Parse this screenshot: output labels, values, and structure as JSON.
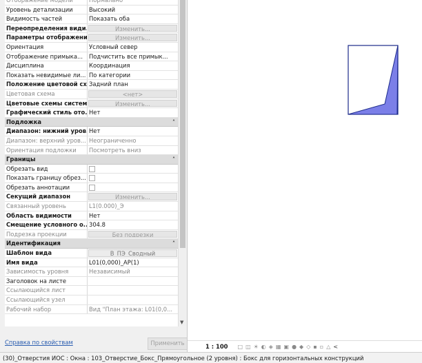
{
  "properties": {
    "rows_top": [
      {
        "name": "Отображение модели",
        "value": "Нормально",
        "style": "gray",
        "kind": "text"
      },
      {
        "name": "Уровень детализации",
        "value": "Высокий",
        "style": "",
        "kind": "text"
      },
      {
        "name": "Видимость частей",
        "value": "Показать оба",
        "style": "",
        "kind": "text"
      },
      {
        "name": "Переопределения види...",
        "value": "Изменить...",
        "style": "bold",
        "kind": "button"
      },
      {
        "name": "Параметры отображени...",
        "value": "Изменить...",
        "style": "bold",
        "kind": "button"
      },
      {
        "name": "Ориентация",
        "value": "Условный север",
        "style": "",
        "kind": "text"
      },
      {
        "name": "Отображение примыка...",
        "value": "Подчистить все примык...",
        "style": "",
        "kind": "text"
      },
      {
        "name": "Дисциплина",
        "value": "Координация",
        "style": "",
        "kind": "text"
      },
      {
        "name": "Показать невидимые ли...",
        "value": "По категории",
        "style": "",
        "kind": "text"
      },
      {
        "name": "Положение цветовой сх...",
        "value": "Задний план",
        "style": "bold",
        "kind": "text"
      },
      {
        "name": "Цветовая схема",
        "value": "<нет>",
        "style": "gray",
        "kind": "button"
      },
      {
        "name": "Цветовые схемы системы",
        "value": "Изменить...",
        "style": "bold",
        "kind": "button"
      },
      {
        "name": "Графический стиль ото...",
        "value": "Нет",
        "style": "bold",
        "kind": "text"
      }
    ],
    "section_underlay": "Подложка",
    "rows_underlay": [
      {
        "name": "Диапазон: нижний уров...",
        "value": "Нет",
        "style": "bold",
        "kind": "text"
      },
      {
        "name": "Диапазон: верхний уров...",
        "value": "Неограниченно",
        "style": "gray",
        "kind": "text"
      },
      {
        "name": "Ориентация подложки",
        "value": "Посмотреть вниз",
        "style": "gray",
        "kind": "text"
      }
    ],
    "section_bounds": "Границы",
    "rows_bounds": [
      {
        "name": "Обрезать вид",
        "value": "",
        "style": "",
        "kind": "check"
      },
      {
        "name": "Показать границу обрез...",
        "value": "",
        "style": "",
        "kind": "check"
      },
      {
        "name": "Обрезать аннотации",
        "value": "",
        "style": "",
        "kind": "check"
      },
      {
        "name": "Секущий диапазон",
        "value": "Изменить...",
        "style": "bold",
        "kind": "button"
      },
      {
        "name": "Связанный уровень",
        "value": "L1(0.000)_Э",
        "style": "gray",
        "kind": "text"
      },
      {
        "name": "Область видимости",
        "value": "Нет",
        "style": "bold",
        "kind": "text"
      },
      {
        "name": "Смещение условного о...",
        "value": "304.8",
        "style": "bold",
        "kind": "text"
      },
      {
        "name": "Подрезка проекции",
        "value": "Без подрезки",
        "style": "gray",
        "kind": "button"
      }
    ],
    "section_identity": "Идентификация",
    "rows_identity": [
      {
        "name": "Шаблон вида",
        "value": "В_ПЭ_Сводный",
        "style": "bold",
        "kind": "buttondark"
      },
      {
        "name": "Имя вида",
        "value": "L01(0,000)_АР(1)",
        "style": "bold",
        "kind": "text"
      },
      {
        "name": "Зависимость уровня",
        "value": "Независимый",
        "style": "gray",
        "kind": "text"
      },
      {
        "name": "Заголовок на листе",
        "value": "",
        "style": "",
        "kind": "text"
      },
      {
        "name": "Ссылающийся лист",
        "value": "",
        "style": "gray",
        "kind": "text"
      },
      {
        "name": "Ссылающийся узел",
        "value": "",
        "style": "gray",
        "kind": "text"
      },
      {
        "name": "Рабочий набор",
        "value": "Вид \"План этажа: L01(0,0...",
        "style": "gray",
        "kind": "text"
      }
    ],
    "help_link": "Справка по свойствам",
    "apply_button": "Применить"
  },
  "view": {
    "scale": "1 : 100",
    "shape_fill": "#7b7fe8",
    "shape_stroke": "#1b2a8a"
  },
  "status": {
    "text": "(30)_Отверстия ИОС : Окна : 103_Отверстие_Бокс_Прямоугольное (2 уровня) : Бокс для горизонтальных конструкций"
  }
}
